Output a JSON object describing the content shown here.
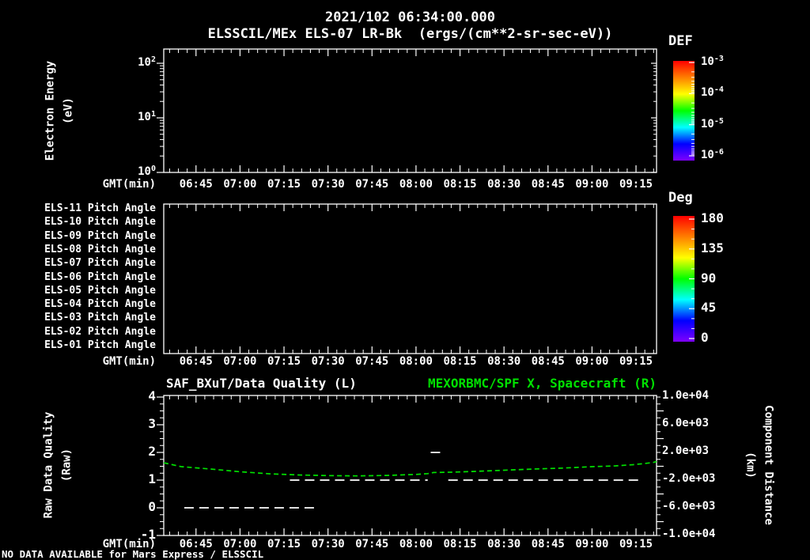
{
  "title": {
    "line1": "2021/102 06:34:00.000",
    "line2": "ELSSCIL/MEx ELS-07 LR-Bk  (ergs/(cm**2-sr-sec-eV))"
  },
  "footer": {
    "notice": "NO DATA AVAILABLE for Mars Express / ELSSCIL"
  },
  "colors": {
    "background": "#000000",
    "foreground": "#ffffff",
    "accent_green": "#00e100",
    "rainbow_top_to_bottom": [
      "#ff0000",
      "#ff7f00",
      "#ffff00",
      "#00ff00",
      "#00ffff",
      "#0000ff",
      "#7f00ff"
    ]
  },
  "time_axis": {
    "label": "GMT(min)",
    "start": "06:34",
    "end": "09:22",
    "major_ticks": [
      "06:45",
      "07:00",
      "07:15",
      "07:30",
      "07:45",
      "08:00",
      "08:15",
      "08:30",
      "08:45",
      "09:00",
      "09:15"
    ],
    "minor_tick_minutes": 3
  },
  "chart_data": [
    {
      "id": "electron-energy-spectrogram",
      "type": "heatmap",
      "title": "ELSSCIL/MEx ELS-07 LR-Bk (ergs/(cm**2-sr-sec-eV))",
      "xlabel": "GMT(min)",
      "ylabel": "Electron Energy (eV)",
      "ylabel_lines": [
        "Electron Energy",
        "(eV)"
      ],
      "y_scale": "log",
      "ylim": [
        1,
        180
      ],
      "y_ticks": [
        {
          "base": 10,
          "exp": 2
        },
        {
          "base": 10,
          "exp": 1
        },
        {
          "base": 10,
          "exp": 0
        }
      ],
      "colorbar": {
        "label": "DEF",
        "scale": "log",
        "tick_labels": [
          {
            "base": 10,
            "exp": -3
          },
          {
            "base": 10,
            "exp": -4
          },
          {
            "base": 10,
            "exp": -5
          },
          {
            "base": 10,
            "exp": -6
          }
        ]
      },
      "values": [],
      "note": "no data plotted"
    },
    {
      "id": "pitch-angle-rows",
      "type": "heatmap",
      "xlabel": "GMT(min)",
      "rows": [
        "ELS-11 Pitch Angle",
        "ELS-10 Pitch Angle",
        "ELS-09 Pitch Angle",
        "ELS-08 Pitch Angle",
        "ELS-07 Pitch Angle",
        "ELS-06 Pitch Angle",
        "ELS-05 Pitch Angle",
        "ELS-04 Pitch Angle",
        "ELS-03 Pitch Angle",
        "ELS-02 Pitch Angle",
        "ELS-01 Pitch Angle"
      ],
      "colorbar": {
        "label": "Deg",
        "ticks": [
          180,
          135,
          90,
          45,
          0
        ]
      },
      "values": [],
      "note": "no data plotted"
    },
    {
      "id": "quality-and-spacecraft-distance",
      "type": "line",
      "title_left": "SAF_BXuT/Data Quality (L)",
      "title_right": "MEXORBMC/SPF X, Spacecraft (R)",
      "xlabel": "GMT(min)",
      "left_axis": {
        "label": "Raw Data Quality (Raw)",
        "label_lines": [
          "Raw Data Quality",
          "(Raw)"
        ],
        "ticks": [
          4,
          3,
          2,
          1,
          0,
          -1
        ],
        "range": [
          -1,
          4
        ]
      },
      "right_axis": {
        "label": "Component Distance (km)",
        "label_lines": [
          "Component Distance",
          "(km)"
        ],
        "ticks": [
          "1.0e+04",
          "6.0e+03",
          "2.0e+03",
          "-2.0e+03",
          "-6.0e+03",
          "-1.0e+04"
        ],
        "range": [
          -10000,
          10000
        ]
      },
      "series": [
        {
          "name": "SAF_BXuT/Data Quality",
          "axis": "left",
          "color": "#ffffff",
          "line_style": "dashed",
          "segments": [
            {
              "value": 0,
              "start": "06:41",
              "end": "07:27"
            },
            {
              "value": 1,
              "start": "07:17",
              "end": "08:04"
            },
            {
              "value": 2,
              "start": "08:05",
              "end": "08:10"
            },
            {
              "value": 1,
              "start": "08:11",
              "end": "09:17"
            }
          ]
        },
        {
          "name": "MEXORBMC/SPF X, Spacecraft",
          "axis": "right",
          "color": "#00e100",
          "line_style": "dashed",
          "points": [
            {
              "t": "06:34",
              "km": 500
            },
            {
              "t": "06:40",
              "km": -60
            },
            {
              "t": "06:50",
              "km": -400
            },
            {
              "t": "07:00",
              "km": -790
            },
            {
              "t": "07:10",
              "km": -1080
            },
            {
              "t": "07:20",
              "km": -1260
            },
            {
              "t": "07:30",
              "km": -1350
            },
            {
              "t": "07:40",
              "km": -1390
            },
            {
              "t": "07:50",
              "km": -1330
            },
            {
              "t": "08:00",
              "km": -1180
            },
            {
              "t": "08:04",
              "km": -1060
            },
            {
              "t": "08:06",
              "km": -900
            },
            {
              "t": "08:12",
              "km": -860
            },
            {
              "t": "08:20",
              "km": -740
            },
            {
              "t": "08:30",
              "km": -570
            },
            {
              "t": "08:40",
              "km": -400
            },
            {
              "t": "08:50",
              "km": -260
            },
            {
              "t": "09:00",
              "km": -60
            },
            {
              "t": "09:08",
              "km": 60
            },
            {
              "t": "09:14",
              "km": 230
            },
            {
              "t": "09:18",
              "km": 400
            },
            {
              "t": "09:21",
              "km": 560
            },
            {
              "t": "09:22",
              "km": 690
            }
          ]
        }
      ]
    }
  ]
}
